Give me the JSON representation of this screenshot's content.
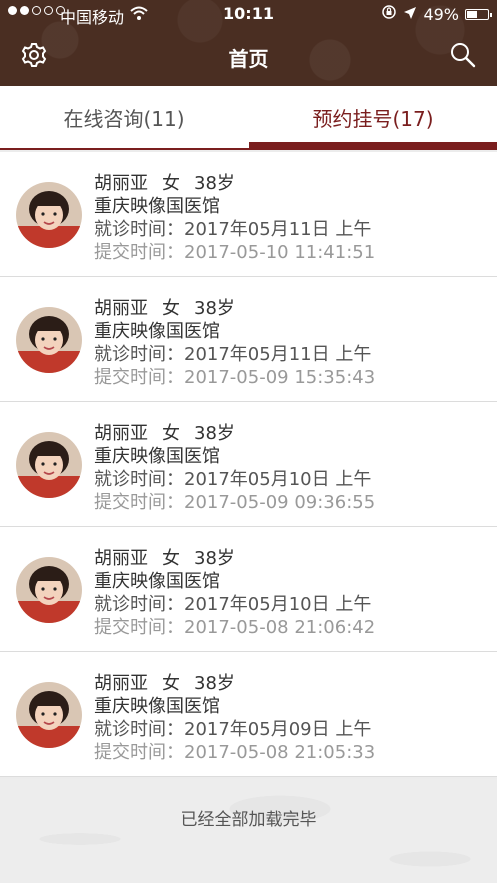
{
  "status_bar": {
    "carrier": "中国移动",
    "time": "10:11",
    "battery": "49%",
    "battery_level": 0.49
  },
  "nav": {
    "title": "首页",
    "settings_icon": "gear-icon",
    "search_icon": "search-icon"
  },
  "tabs": [
    {
      "label": "在线咨询(11)",
      "active": false
    },
    {
      "label": "预约挂号(17)",
      "active": true
    }
  ],
  "list": {
    "visit_label": "就诊时间：",
    "submit_label": "提交时间：",
    "items": [
      {
        "name": "胡丽亚",
        "gender": "女",
        "age": "38岁",
        "hospital": "重庆映像国医馆",
        "visit_time": "2017年05月11日 上午",
        "submit_time": "2017-05-10 11:41:51"
      },
      {
        "name": "胡丽亚",
        "gender": "女",
        "age": "38岁",
        "hospital": "重庆映像国医馆",
        "visit_time": "2017年05月11日 上午",
        "submit_time": "2017-05-09 15:35:43"
      },
      {
        "name": "胡丽亚",
        "gender": "女",
        "age": "38岁",
        "hospital": "重庆映像国医馆",
        "visit_time": "2017年05月10日 上午",
        "submit_time": "2017-05-09 09:36:55"
      },
      {
        "name": "胡丽亚",
        "gender": "女",
        "age": "38岁",
        "hospital": "重庆映像国医馆",
        "visit_time": "2017年05月10日 上午",
        "submit_time": "2017-05-08 21:06:42"
      },
      {
        "name": "胡丽亚",
        "gender": "女",
        "age": "38岁",
        "hospital": "重庆映像国医馆",
        "visit_time": "2017年05月09日 上午",
        "submit_time": "2017-05-08 21:05:33"
      }
    ]
  },
  "footer": {
    "text": "已经全部加载完毕"
  },
  "colors": {
    "header": "#4a2e22",
    "accent": "#7a1e1e"
  }
}
